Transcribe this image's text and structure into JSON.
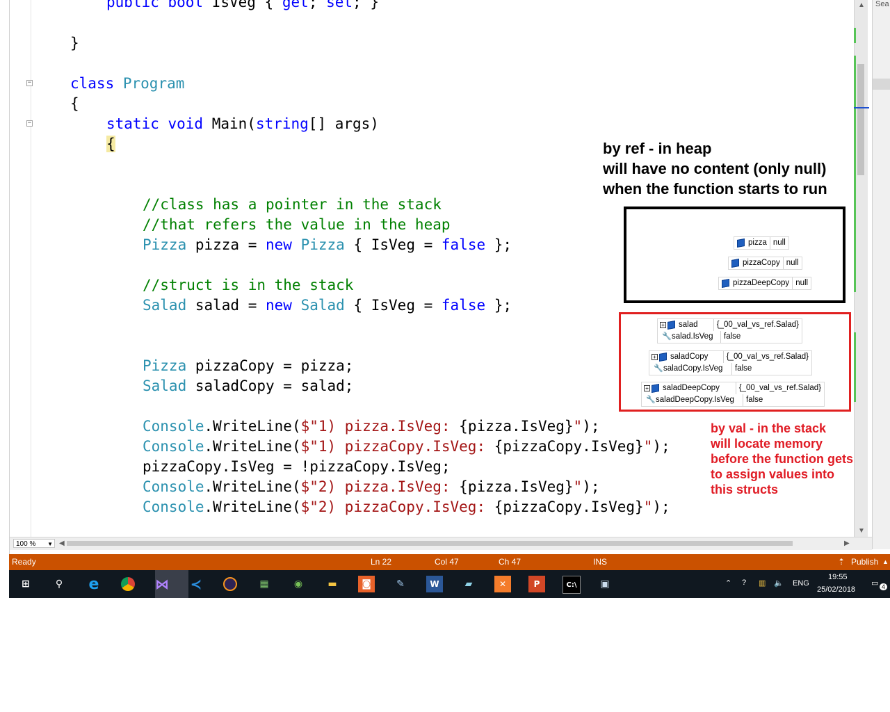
{
  "editor": {
    "code_line_1": "public bool IsVeg { get; set; }",
    "code_line_2": "}",
    "code_line_3": "class Program",
    "code_line_4": "{",
    "code_line_5": "static void Main(string[] args)",
    "code_line_6": "{",
    "code_line_7": "//class has a pointer in the stack",
    "code_line_8": "//that refers the value in the heap",
    "code_line_9": "Pizza pizza = new Pizza { IsVeg = false };",
    "code_line_10": "//struct is in the stack",
    "code_line_11": "Salad salad = new Salad { IsVeg = false };",
    "code_line_12": "Pizza pizzaCopy = pizza;",
    "code_line_13": "Salad saladCopy = salad;",
    "code_line_14": "Console.WriteLine($\"1) pizza.IsVeg: {pizza.IsVeg}\");",
    "code_line_15": "Console.WriteLine($\"1) pizzaCopy.IsVeg: {pizzaCopy.IsVeg}\");",
    "code_line_16": "pizzaCopy.IsVeg = !pizzaCopy.IsVeg;",
    "code_line_17": "Console.WriteLine($\"2) pizza.IsVeg: {pizza.IsVeg}\");",
    "code_line_18": "Console.WriteLine($\"2) pizzaCopy.IsVeg: {pizzaCopy.IsVeg}\");"
  },
  "annotations": {
    "heap_line_1": "by ref - in heap",
    "heap_line_2": "will have no content (only null)",
    "heap_line_3": "when the function starts to run",
    "stack_line_1": "by val - in the stack",
    "stack_line_2": "will locate memory",
    "stack_line_3": "before the function gets",
    "stack_line_4": "to assign values into",
    "stack_line_5": "this structs"
  },
  "datatips_heap": [
    {
      "name": "pizza",
      "value": "null"
    },
    {
      "name": "pizzaCopy",
      "value": "null"
    },
    {
      "name": "pizzaDeepCopy",
      "value": "null"
    }
  ],
  "datatips_stack": [
    {
      "name": "salad",
      "value": "{_00_val_vs_ref.Salad}",
      "member": "salad.IsVeg",
      "member_value": "false"
    },
    {
      "name": "saladCopy",
      "value": "{_00_val_vs_ref.Salad}",
      "member": "saladCopy.IsVeg",
      "member_value": "false"
    },
    {
      "name": "saladDeepCopy",
      "value": "{_00_val_vs_ref.Salad}",
      "member": "saladDeepCopy.IsVeg",
      "member_value": "false"
    }
  ],
  "zoom": {
    "value": "100 %"
  },
  "right_pane": {
    "search_label": "Sea"
  },
  "status": {
    "ready": "Ready",
    "line": "Ln 22",
    "col": "Col 47",
    "ch": "Ch 47",
    "ins": "INS",
    "publish": "Publish"
  },
  "colors": {
    "status_bar": "#ca5100",
    "annotation_red": "#e01b24",
    "keyword": "#0000ff",
    "type": "#2b91af",
    "comment": "#008000",
    "string": "#a31515"
  },
  "taskbar": {
    "icons": [
      "windows-start",
      "search",
      "internet-explorer",
      "chrome",
      "visual-studio",
      "vs-code",
      "eclipse",
      "calculator",
      "android-studio",
      "file-explorer",
      "orange-app",
      "paint-app",
      "word",
      "notepad-app",
      "xampp",
      "powerpoint",
      "command-prompt",
      "screenshot-app"
    ],
    "language": "ENG",
    "time": "19:55",
    "date": "25/02/2018",
    "notifications": "4"
  }
}
